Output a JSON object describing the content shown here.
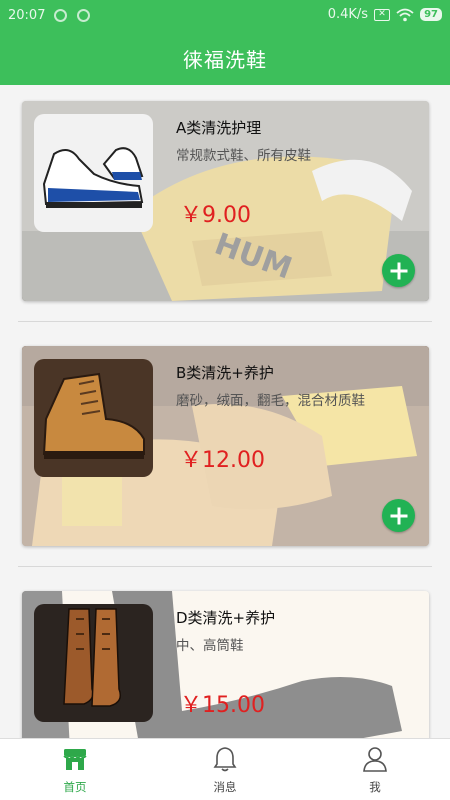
{
  "status_bar": {
    "time": "20:07",
    "net_speed": "0.4K/s",
    "sim_icon": "sim-x-icon",
    "wifi_icon": "wifi-icon",
    "battery": "97"
  },
  "app_bar": {
    "title": "徕福洗鞋"
  },
  "products": [
    {
      "name": "A类清洗护理",
      "desc": "常规款式鞋、所有皮鞋",
      "price": "￥9.00",
      "thumb_icon": "sneaker-icon",
      "add_icon": "plus-icon"
    },
    {
      "name": "B类清洗+养护",
      "desc": "磨砂，绒面，翻毛，混合材质鞋",
      "price": "￥12.00",
      "thumb_icon": "work-boot-icon",
      "add_icon": "plus-icon"
    },
    {
      "name": "D类清洗+养护",
      "desc": "中、高筒鞋",
      "price": "￥15.00",
      "thumb_icon": "tall-boot-icon",
      "add_icon": "plus-icon"
    }
  ],
  "tab_bar": {
    "tabs": [
      {
        "label": "首页",
        "icon": "store-icon",
        "active": true
      },
      {
        "label": "消息",
        "icon": "bell-icon",
        "active": false
      },
      {
        "label": "我",
        "icon": "user-icon",
        "active": false
      }
    ]
  },
  "colors": {
    "primary": "#3dbf5b",
    "price": "#e02020",
    "add_button": "#21b254",
    "tab_active": "#2ea84a"
  }
}
